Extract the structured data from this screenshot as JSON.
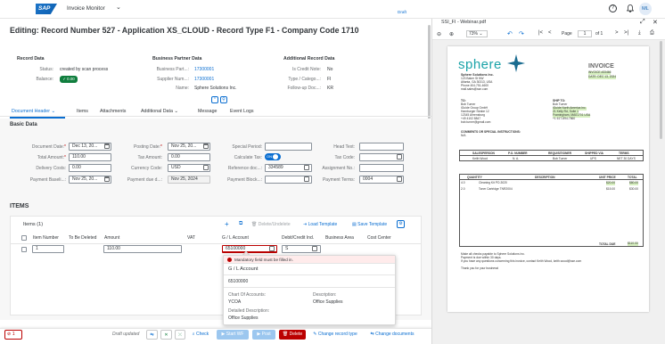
{
  "shell": {
    "app_title": "Invoice Monitor",
    "logo": "SAP",
    "avatar": "ML"
  },
  "header": {
    "title": "Editing: Record Number 527 - Application XS_CLOUD - Record Type F1 - Company Code 1710",
    "draft": "Draft"
  },
  "record_data": {
    "heading": "Record Data",
    "status_label": "Status:",
    "status_value": "created by scan process",
    "balance_label": "Balance:",
    "balance_value": "0.00"
  },
  "bp_data": {
    "heading": "Business Partner Data",
    "bp_label": "Business Part...:",
    "bp_value": "17300001",
    "supplier_label": "Supplier Num...:",
    "supplier_value": "17300001",
    "name_label": "Name:",
    "name_value": "Sphere Solutions Inc."
  },
  "additional": {
    "heading": "Additional Record Data",
    "credit_label": "Is Credit Note:",
    "credit_value": "No",
    "type_label": "Type / Catego...:",
    "type_value": "FI",
    "followup_label": "Follow-up Doc...:",
    "followup_value": "KR"
  },
  "tabs": [
    "Document Header",
    "Items",
    "Attachments",
    "Additional Data",
    "Message",
    "Event Logs"
  ],
  "basic": {
    "heading": "Basic Data",
    "doc_date_label": "Document Date:",
    "doc_date": "Dec 13, 20...",
    "total_label": "Total Amount:",
    "total": "110.00",
    "delivery_label": "Delivery Costs:",
    "delivery": "0.00",
    "baseline_label": "Payment Baseli...:",
    "baseline": "Nov 25, 20...",
    "posting_label": "Posting Date:",
    "posting": "Nov 25, 20...",
    "tax_label": "Tax Amount:",
    "tax": "0.00",
    "currency_label": "Currency Code:",
    "currency": "USD",
    "paydue_label": "Payment due d...:",
    "paydue": "Nov 25, 2024",
    "special_label": "Special Period:",
    "special": "",
    "calctax_label": "Calculate Tax:",
    "calctax": "ON",
    "refdoc_label": "Reference doc...:",
    "refdoc": "334589",
    "payblock_label": "Payment Block...:",
    "payblock": "",
    "headtext_label": "Head Text:",
    "headtext": "",
    "taxcode_label": "Tax Code:",
    "taxcode": "",
    "assign_label": "Assignment No.:",
    "assign": "",
    "payterms_label": "Payment Terms:",
    "payterms": "0004"
  },
  "items": {
    "heading": "ITEMS",
    "table_title": "Items (1)",
    "btn_delete": "Delete/Undelete",
    "btn_load": "Load Template",
    "btn_save": "Save Template",
    "columns": [
      "Item Number",
      "To Be Deleted",
      "Amount",
      "VAT",
      "G / L Account",
      "Debit/Credit Ind.",
      "Business Area",
      "Cost Center"
    ],
    "row": {
      "item": "1",
      "amount": "110.00",
      "gl": "65100000",
      "dc": "S"
    }
  },
  "popover": {
    "error": "Mandatory field must be filled in.",
    "title": "G / L Account",
    "value": "65100000",
    "coa_label": "Chart Of Accounts:",
    "coa": "YCOA",
    "desc_label": "Description:",
    "desc": "Office Supplies",
    "detail_label": "Detailed Description:",
    "detail": "Office Supplies"
  },
  "footer": {
    "msg_count": "1",
    "draft_status": "Draft updated",
    "check": "Check",
    "start_wf": "Start WF",
    "post": "Post",
    "delete": "Delete",
    "change_type": "Change record type",
    "change_docs": "Change documents"
  },
  "pdf": {
    "file": "SSI_FI - Webinar.pdf",
    "zoom": "73%",
    "page_label": "Page",
    "page": "1",
    "of": "of 1",
    "company": "Sphere Solutions Inc.",
    "address": [
      "123 Baker St NW",
      "Atlanta, GA 30313, USA",
      "Phone 404-751-4600",
      "mail.sales@sse.com"
    ],
    "invoice_title": "INVOICE",
    "invoice_no": "INVOICE #33466",
    "invoice_date": "DATE: DEC 13, 2024",
    "to_label": "TO:",
    "to": [
      "Bob Turner",
      "iGuide Group GmbH",
      "Hamburger Strabe 12",
      "12345 Ahrensburg",
      "+49 4102 8847",
      "bob.turner@gmail.com"
    ],
    "ship_label": "SHIP TO:",
    "ship": [
      "Bob Turner",
      "iGuide North America Inc.",
      "21 Kelly Rd, Suite 1",
      "Framingham, MA01701 USA",
      "+1 617-894-7860"
    ],
    "comments": "COMMENTS OR SPECIAL INSTRUCTIONS:",
    "comments_val": "N/A",
    "row1_heads": [
      "SALESPERSON",
      "P.O. NUMBER",
      "REQUISITIONER",
      "SHIPPED VIA",
      "TERMS"
    ],
    "row1_vals": [
      "Keith Wood",
      "N. A.",
      "Bob Turner",
      "UPS",
      "NET 30 DAYS"
    ],
    "row2_heads": [
      "QUANTITY",
      "DESCRIPTION",
      "UNIT PRICE",
      "TOTAL"
    ],
    "lines": [
      {
        "qty": "4.0",
        "desc": "Cleaning Kit PO-3020",
        "unit": "$20.00",
        "total": "$80.00"
      },
      {
        "qty": "2.0",
        "desc": "Toner Cartridge TNR2004",
        "unit": "$15.00",
        "total": "$30.00"
      }
    ],
    "total_due_label": "TOTAL DUE",
    "total_due": "$110.00",
    "notes": [
      "Make all checks payable to Sphere Solutions Inc.",
      "Payment is due within 30 days.",
      "If you have any questions concerning this invoice, contact Keith Wood, keith.wood@sse.com",
      "",
      "Thank you for your business!"
    ]
  },
  "colors": {
    "accent": "#0a6ed1",
    "error": "#bb0000",
    "success": "#107e3e",
    "brand_teal": "#1aa3a8"
  }
}
